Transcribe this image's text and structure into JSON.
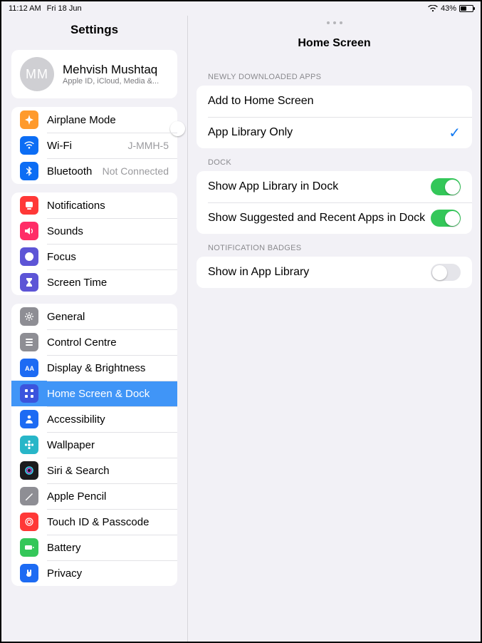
{
  "status": {
    "time": "11:12 AM",
    "date": "Fri 18 Jun",
    "battery_pct": "43%"
  },
  "sidebar": {
    "title": "Settings",
    "profile": {
      "initials": "MM",
      "name": "Mehvish Mushtaq",
      "sub": "Apple ID, iCloud, Media &..."
    },
    "g1": [
      {
        "label": "Airplane Mode",
        "icon": "airplane",
        "bg": "#ff9a2c",
        "trail_type": "switch",
        "on": false
      },
      {
        "label": "Wi-Fi",
        "icon": "wifi",
        "bg": "#0c6df4",
        "trail": "J-MMH-5"
      },
      {
        "label": "Bluetooth",
        "icon": "bluetooth",
        "bg": "#0c6df4",
        "trail": "Not Connected"
      }
    ],
    "g2": [
      {
        "label": "Notifications",
        "icon": "bell",
        "bg": "#ff3837"
      },
      {
        "label": "Sounds",
        "icon": "speaker",
        "bg": "#ff2d67"
      },
      {
        "label": "Focus",
        "icon": "moon",
        "bg": "#5d55d6"
      },
      {
        "label": "Screen Time",
        "icon": "hourglass",
        "bg": "#5d55d6"
      }
    ],
    "g3": [
      {
        "label": "General",
        "icon": "gear",
        "bg": "#8e8e94"
      },
      {
        "label": "Control Centre",
        "icon": "sliders",
        "bg": "#8e8e94"
      },
      {
        "label": "Display & Brightness",
        "icon": "letters",
        "bg": "#1d6bf3"
      },
      {
        "label": "Home Screen & Dock",
        "icon": "grid",
        "bg": "#3b54dd",
        "selected": true
      },
      {
        "label": "Accessibility",
        "icon": "person",
        "bg": "#1d6bf3"
      },
      {
        "label": "Wallpaper",
        "icon": "flower",
        "bg": "#28b6c8"
      },
      {
        "label": "Siri & Search",
        "icon": "siri",
        "bg": "#1b1b1d"
      },
      {
        "label": "Apple Pencil",
        "icon": "pencil",
        "bg": "#8e8e94"
      },
      {
        "label": "Touch ID & Passcode",
        "icon": "finger",
        "bg": "#ff3837"
      },
      {
        "label": "Battery",
        "icon": "battery",
        "bg": "#34c759"
      },
      {
        "label": "Privacy",
        "icon": "hand",
        "bg": "#1d6bf3"
      }
    ]
  },
  "content": {
    "title": "Home Screen",
    "groups": [
      {
        "header": "NEWLY DOWNLOADED APPS",
        "rows": [
          {
            "label": "Add to Home Screen",
            "checked": false
          },
          {
            "label": "App Library Only",
            "checked": true
          }
        ]
      },
      {
        "header": "DOCK",
        "rows": [
          {
            "label": "Show App Library in Dock",
            "switch": true
          },
          {
            "label": "Show Suggested and Recent Apps in Dock",
            "switch": true
          }
        ]
      },
      {
        "header": "NOTIFICATION BADGES",
        "rows": [
          {
            "label": "Show in App Library",
            "switch": false
          }
        ]
      }
    ]
  }
}
